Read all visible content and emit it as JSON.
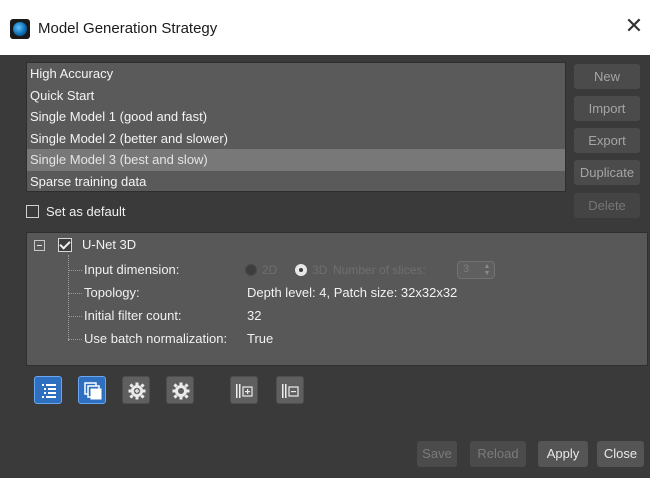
{
  "window": {
    "title": "Model Generation Strategy",
    "close_glyph": "✕"
  },
  "strategies": [
    {
      "label": "High Accuracy",
      "selected": false
    },
    {
      "label": "Quick Start",
      "selected": false
    },
    {
      "label": "Single Model 1 (good and fast)",
      "selected": false
    },
    {
      "label": "Single Model 2 (better and slower)",
      "selected": false
    },
    {
      "label": "Single Model 3 (best and slow)",
      "selected": true
    },
    {
      "label": "Sparse training data",
      "selected": false
    }
  ],
  "side_buttons": {
    "new": "New",
    "import": "Import",
    "export": "Export",
    "duplicate": "Duplicate",
    "delete": "Delete"
  },
  "default_option": {
    "label": "Set as default",
    "checked": false
  },
  "model_tree": {
    "node_label": "U-Net 3D",
    "node_checked": true,
    "input_dimension": {
      "label": "Input dimension:",
      "option_2d": "2D",
      "option_3d": "3D",
      "selected": "3D",
      "slices_label": "Number of slices:",
      "slices_value": "3"
    },
    "topology": {
      "label": "Topology:",
      "value": "Depth level: 4, Patch size: 32x32x32"
    },
    "initial_filter_count": {
      "label": "Initial filter count:",
      "value": "32"
    },
    "batch_normalization": {
      "label": "Use batch normalization:",
      "value": "True"
    }
  },
  "toolbar": [
    {
      "icon": "list-view-icon",
      "active": true
    },
    {
      "icon": "copy-layers-icon",
      "active": true
    },
    {
      "icon": "gear-add-icon",
      "active": false
    },
    {
      "icon": "gear-icon",
      "active": false
    },
    {
      "icon": "add-column-icon",
      "active": false
    },
    {
      "icon": "remove-column-icon",
      "active": false
    }
  ],
  "bottom_buttons": {
    "save": "Save",
    "reload": "Reload",
    "apply": "Apply",
    "close": "Close"
  },
  "colors": {
    "background": "#3a3a3a",
    "panel": "#585858",
    "selected_row": "#787878",
    "accent": "#2f6fc0"
  }
}
